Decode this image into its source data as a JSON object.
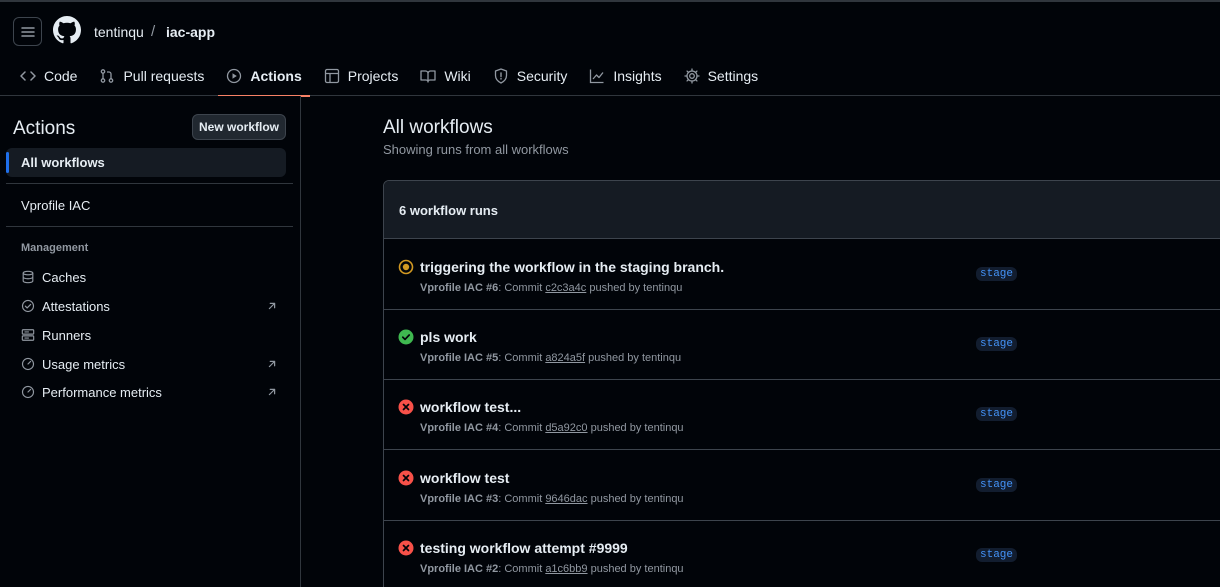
{
  "header": {
    "owner": "tentinqu",
    "separator": "/",
    "repo": "iac-app",
    "tabs": [
      {
        "label": "Code",
        "icon": "code-icon"
      },
      {
        "label": "Pull requests",
        "icon": "pull-request-icon"
      },
      {
        "label": "Actions",
        "icon": "play-icon",
        "active": true
      },
      {
        "label": "Projects",
        "icon": "table-icon"
      },
      {
        "label": "Wiki",
        "icon": "book-icon"
      },
      {
        "label": "Security",
        "icon": "shield-icon"
      },
      {
        "label": "Insights",
        "icon": "graph-icon"
      },
      {
        "label": "Settings",
        "icon": "gear-icon"
      }
    ]
  },
  "sidebar": {
    "title": "Actions",
    "new_workflow": "New workflow",
    "all_workflows": "All workflows",
    "workflows": [
      "Vprofile IAC"
    ],
    "management_label": "Management",
    "management": [
      {
        "label": "Caches",
        "icon": "database-icon",
        "external": false
      },
      {
        "label": "Attestations",
        "icon": "verified-icon",
        "external": true
      },
      {
        "label": "Runners",
        "icon": "server-icon",
        "external": false
      },
      {
        "label": "Usage metrics",
        "icon": "meter-icon",
        "external": true
      },
      {
        "label": "Performance metrics",
        "icon": "meter-icon",
        "external": true
      }
    ]
  },
  "main": {
    "title": "All workflows",
    "subtitle": "Showing runs from all workflows",
    "runs_count": "6 workflow runs",
    "runs": [
      {
        "title": "triggering the workflow in the staging branch.",
        "workflow": "Vprofile IAC #6",
        "commit_label": ": Commit ",
        "sha": "c2c3a4c",
        "pushed_by": " pushed by tentinqu",
        "branch": "stage",
        "status": "in-progress"
      },
      {
        "title": "pls work",
        "workflow": "Vprofile IAC #5",
        "commit_label": ": Commit ",
        "sha": "a824a5f",
        "pushed_by": " pushed by tentinqu",
        "branch": "stage",
        "status": "success"
      },
      {
        "title": "workflow test...",
        "workflow": "Vprofile IAC #4",
        "commit_label": ": Commit ",
        "sha": "d5a92c0",
        "pushed_by": " pushed by tentinqu",
        "branch": "stage",
        "status": "failure"
      },
      {
        "title": "workflow test",
        "workflow": "Vprofile IAC #3",
        "commit_label": ": Commit ",
        "sha": "9646dac",
        "pushed_by": " pushed by tentinqu",
        "branch": "stage",
        "status": "failure"
      },
      {
        "title": "testing workflow attempt #9999",
        "workflow": "Vprofile IAC #2",
        "commit_label": ": Commit ",
        "sha": "a1c6bb9",
        "pushed_by": " pushed by tentinqu",
        "branch": "stage",
        "status": "failure"
      }
    ]
  },
  "colors": {
    "accent_tab": "#f78166",
    "link": "#4493f8",
    "success": "#3fb950",
    "failure": "#f85149",
    "in_progress": "#d29922"
  }
}
